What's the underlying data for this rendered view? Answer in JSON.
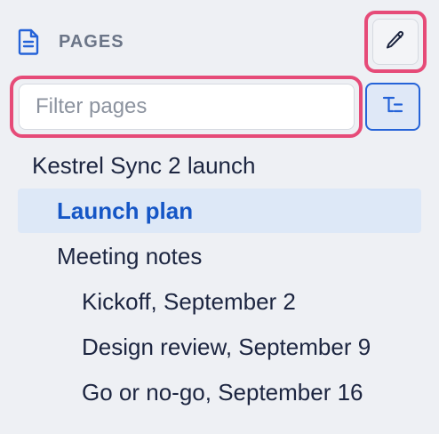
{
  "header": {
    "title": "PAGES",
    "icon": "document-icon"
  },
  "toolbar": {
    "edit_icon": "pencil-icon",
    "tree_toggle_icon": "tree-structure-icon"
  },
  "filter": {
    "placeholder": "Filter pages",
    "value": ""
  },
  "tree": {
    "root": {
      "label": "Kestrel Sync 2 launch"
    },
    "children": [
      {
        "label": "Launch plan",
        "active": true
      },
      {
        "label": "Meeting notes",
        "children": [
          {
            "label": "Kickoff, September 2"
          },
          {
            "label": "Design review, September 9"
          },
          {
            "label": "Go or no-go, September 16"
          }
        ]
      }
    ]
  },
  "colors": {
    "background": "#eef0f4",
    "accent": "#1556c6",
    "highlight_border": "#e64b78",
    "active_row": "#dde8f7"
  }
}
